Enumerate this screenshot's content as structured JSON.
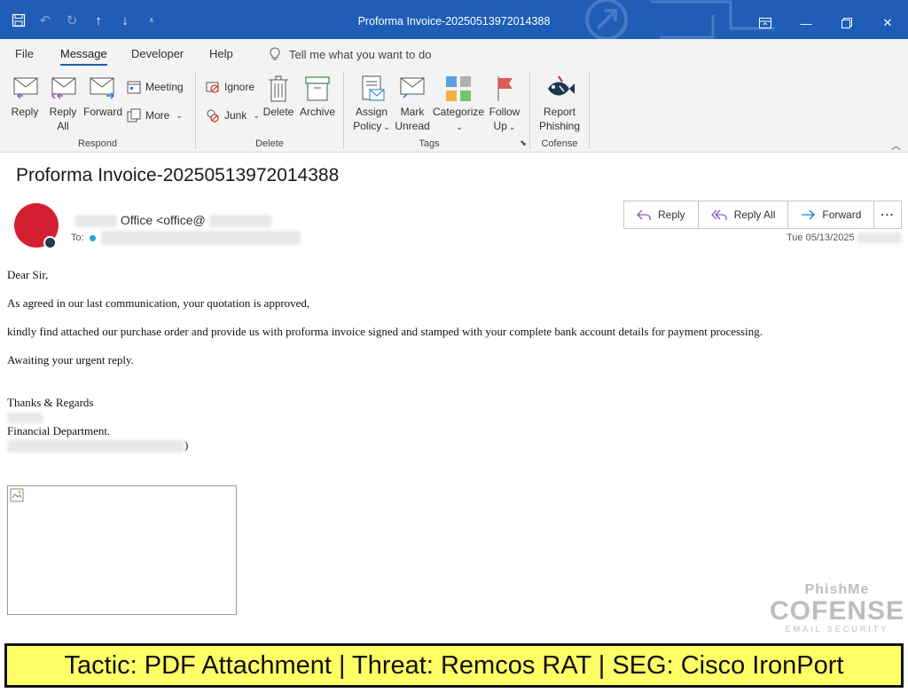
{
  "window": {
    "title": "Proforma Invoice-20250513972014388",
    "quick_access": [
      "save-icon",
      "undo-icon",
      "redo-icon",
      "previous-icon",
      "next-icon",
      "customize-icon"
    ],
    "controls": [
      "ribbon-display-icon",
      "minimize-icon",
      "restore-icon",
      "close-icon"
    ]
  },
  "menu": {
    "tabs": [
      "File",
      "Message",
      "Developer",
      "Help"
    ],
    "active_tab": "Message",
    "tell_me": "Tell me what you want to do"
  },
  "ribbon": {
    "respond": {
      "label": "Respond",
      "reply": "Reply",
      "reply_all_1": "Reply",
      "reply_all_2": "All",
      "forward": "Forward",
      "meeting": "Meeting",
      "more": "More"
    },
    "delete": {
      "label": "Delete",
      "ignore": "Ignore",
      "junk": "Junk",
      "delete": "Delete",
      "archive": "Archive"
    },
    "tags": {
      "label": "Tags",
      "assign_1": "Assign",
      "assign_2": "Policy",
      "mark_1": "Mark",
      "mark_2": "Unread",
      "categorize": "Categorize",
      "follow_1": "Follow",
      "follow_2": "Up"
    },
    "cofense": {
      "label": "Cofense",
      "report_1": "Report",
      "report_2": "Phishing"
    }
  },
  "message": {
    "subject": "Proforma Invoice-20250513972014388",
    "sender_visible": "Office <office@",
    "to_label": "To:",
    "date": "Tue 05/13/2025",
    "actions": [
      "Reply",
      "Reply All",
      "Forward"
    ]
  },
  "body": {
    "greeting": "Dear Sir,",
    "line1": "As agreed in our last communication, your quotation is approved,",
    "line2": "kindly find attached our purchase order and provide us with proforma invoice signed and stamped with your complete bank account details for payment processing.",
    "line3": "Awaiting your urgent reply.",
    "thanks": "Thanks & Regards",
    "department": "Financial Department.",
    "sig_end": ")"
  },
  "watermark": {
    "line1": "PhishMe",
    "line2": "COFENSE",
    "line3": "EMAIL SECURITY"
  },
  "banner": {
    "text": "Tactic: PDF Attachment | Threat: Remcos RAT | SEG: Cisco IronPort"
  },
  "colors": {
    "titlebar": "#1f5db7",
    "avatar": "#d32031",
    "banner_bg": "#ffff66"
  }
}
